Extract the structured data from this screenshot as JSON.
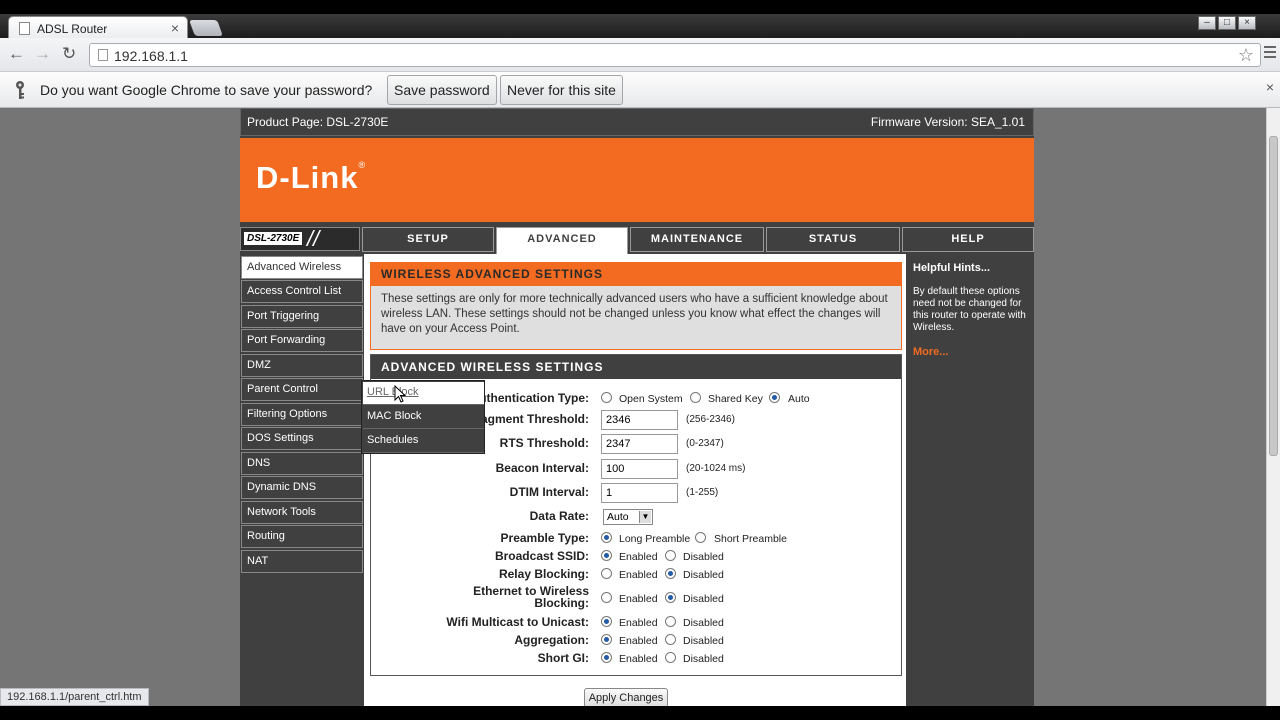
{
  "browser": {
    "tab_title": "ADSL Router",
    "tab_close": "×",
    "url": "192.168.1.1",
    "back": "←",
    "forward": "→",
    "reload": "↻",
    "star": "☆",
    "min": "–",
    "max": "□",
    "close": "×"
  },
  "infobar": {
    "question": "Do you want Google Chrome to save your password?",
    "save_label": "Save password",
    "never_label": "Never for this site",
    "close": "×"
  },
  "status_url": "192.168.1.1/parent_ctrl.htm",
  "router": {
    "product_page": "Product Page: DSL-2730E",
    "firmware": "Firmware Version: SEA_1.01",
    "logo": "D-Link",
    "logo_mark": "®",
    "model": "DSL-2730E",
    "slashes": "//",
    "tabs": [
      {
        "label": "SETUP"
      },
      {
        "label": "ADVANCED"
      },
      {
        "label": "MAINTENANCE"
      },
      {
        "label": "STATUS"
      },
      {
        "label": "HELP"
      }
    ],
    "sidebar": [
      {
        "label": "Advanced Wireless"
      },
      {
        "label": "Access Control List"
      },
      {
        "label": "Port Triggering"
      },
      {
        "label": "Port Forwarding"
      },
      {
        "label": "DMZ"
      },
      {
        "label": "Parent Control"
      },
      {
        "label": "Filtering Options"
      },
      {
        "label": "DOS Settings"
      },
      {
        "label": "DNS"
      },
      {
        "label": "Dynamic DNS"
      },
      {
        "label": "Network Tools"
      },
      {
        "label": "Routing"
      },
      {
        "label": "NAT"
      }
    ],
    "popup": [
      {
        "label": "URL Block"
      },
      {
        "label": "MAC Block"
      },
      {
        "label": "Schedules"
      }
    ],
    "section1": {
      "title": "WIRELESS ADVANCED SETTINGS",
      "description": "These settings are only for more technically advanced users who have a sufficient knowledge about wireless LAN. These settings should not be changed unless you know what effect the changes will have on your Access Point."
    },
    "section2": {
      "title": "ADVANCED WIRELESS SETTINGS",
      "auth": {
        "label": "Authentication Type:",
        "opt1": "Open System",
        "opt2": "Shared Key",
        "opt3": "Auto"
      },
      "frag": {
        "label": "Fragment Threshold:",
        "value": "2346",
        "hint": "(256-2346)"
      },
      "rts": {
        "label": "RTS Threshold:",
        "value": "2347",
        "hint": "(0-2347)"
      },
      "beacon": {
        "label": "Beacon Interval:",
        "value": "100",
        "hint": "(20-1024 ms)"
      },
      "dtim": {
        "label": "DTIM Interval:",
        "value": "1",
        "hint": "(1-255)"
      },
      "rate": {
        "label": "Data Rate:",
        "value": "Auto"
      },
      "preamble": {
        "label": "Preamble Type:",
        "opt1": "Long Preamble",
        "opt2": "Short Preamble"
      },
      "ssid": {
        "label": "Broadcast SSID:",
        "opt1": "Enabled",
        "opt2": "Disabled"
      },
      "relay": {
        "label": "Relay Blocking:",
        "opt1": "Enabled",
        "opt2": "Disabled"
      },
      "e2w": {
        "label1": "Ethernet to Wireless",
        "label2": "Blocking:",
        "opt1": "Enabled",
        "opt2": "Disabled"
      },
      "wifi": {
        "label": "Wifi Multicast to Unicast:",
        "opt1": "Enabled",
        "opt2": "Disabled"
      },
      "agg": {
        "label": "Aggregation:",
        "opt1": "Enabled",
        "opt2": "Disabled"
      },
      "sgi": {
        "label": "Short GI:",
        "opt1": "Enabled",
        "opt2": "Disabled"
      }
    },
    "apply_label": "Apply Changes",
    "hints": {
      "title": "Helpful Hints...",
      "body": "By default these options need not be changed for this router to operate with Wireless.",
      "more": "More..."
    }
  },
  "colors": {
    "dlink_orange": "#f26b21",
    "dark_gray": "#404040",
    "selected_radio": "#245ba8"
  }
}
